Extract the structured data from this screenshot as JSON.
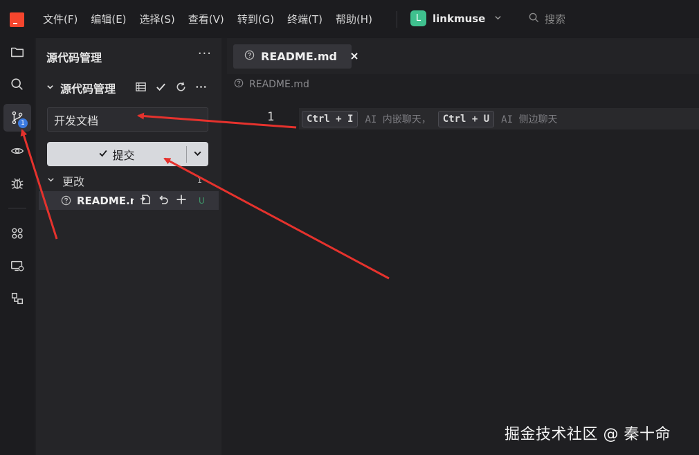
{
  "titlebar": {
    "menu": [
      "文件(F)",
      "编辑(E)",
      "选择(S)",
      "查看(V)",
      "转到(G)",
      "终端(T)",
      "帮助(H)"
    ],
    "project_initial": "L",
    "project_name": "linkmuse",
    "search_label": "搜索"
  },
  "activity": {
    "items": [
      "explorer-icon",
      "search-icon",
      "source-control-icon",
      "eye-icon",
      "bug-icon",
      "extensions-icon",
      "remote-icon",
      "structure-icon"
    ],
    "source_control_badge": "1"
  },
  "sidebar": {
    "title": "源代码管理",
    "more": "···",
    "section_label": "源代码管理",
    "commit_message": "开发文档",
    "commit_label": "提交",
    "changes_label": "更改",
    "changes_count": "1",
    "files": [
      {
        "name": "README.md",
        "status": "U"
      }
    ]
  },
  "editor": {
    "tab_label": "README.md",
    "breadcrumb": "README.md",
    "line_number": "1",
    "hint": {
      "key1": "Ctrl + I",
      "text1": "AI 内嵌聊天，",
      "key2": "Ctrl + U",
      "text2": "AI 侧边聊天"
    }
  },
  "watermark": "掘金技术社区 @ 秦十命",
  "colors": {
    "accent_red": "#f5452d",
    "project_badge": "#3fc08e",
    "badge_blue": "#3b7ae0",
    "untracked_green": "#3f9a6b",
    "annotation_arrow": "#e5322d"
  }
}
